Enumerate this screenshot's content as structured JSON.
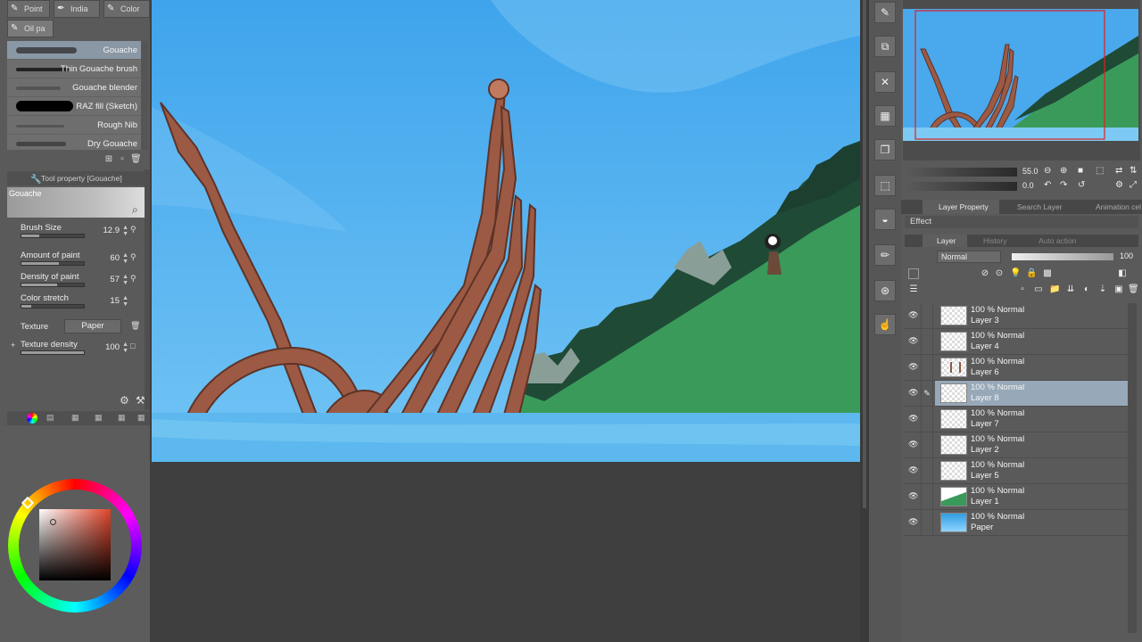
{
  "subtool_tabs": [
    {
      "label": "Point",
      "icon": "pencil-icon"
    },
    {
      "label": "India",
      "icon": "pen-icon"
    },
    {
      "label": "Color",
      "icon": "brush-icon"
    },
    {
      "label": "Oil pa",
      "icon": "oil-brush-icon"
    }
  ],
  "brushes": [
    {
      "name": "Gouache",
      "selected": true
    },
    {
      "name": "Thin Gouache brush",
      "selected": false
    },
    {
      "name": "Gouache blender",
      "selected": false
    },
    {
      "name": "RAZ fill (Sketch)",
      "selected": false
    },
    {
      "name": "Rough Nib",
      "selected": false
    },
    {
      "name": "Dry Gouache",
      "selected": false
    }
  ],
  "tool_property": {
    "header": "Tool property [Gouache]",
    "preview_name": "Gouache",
    "brush_size": {
      "label": "Brush Size",
      "value": "12.9",
      "fraction": 0.28
    },
    "amount_of_paint": {
      "label": "Amount of paint",
      "value": "60",
      "fraction": 0.6
    },
    "density_of_paint": {
      "label": "Density of paint",
      "value": "57",
      "fraction": 0.57
    },
    "color_stretch": {
      "label": "Color stretch",
      "value": "15",
      "fraction": 0.15
    },
    "texture": {
      "label": "Texture",
      "value": "Paper"
    },
    "texture_density": {
      "label": "Texture density",
      "value": "100",
      "fraction": 1.0
    }
  },
  "color": {
    "main_hex": "#e0442a"
  },
  "navigator": {
    "zoom": "55.0",
    "rotation": "0.0"
  },
  "right_tabs": {
    "layer_property": "Layer Property",
    "search_layer": "Search Layer",
    "animation_cel": "Animation cel"
  },
  "effect_label": "Effect",
  "layer_tabs": {
    "layer": "Layer",
    "history": "History",
    "auto_action": "Auto action"
  },
  "blend_mode": "Normal",
  "opacity": "100",
  "layers": [
    {
      "mode": "100 % Normal",
      "name": "Layer 3",
      "thumb": "blank",
      "selected": false
    },
    {
      "mode": "100 % Normal",
      "name": "Layer 4",
      "thumb": "blank",
      "selected": false
    },
    {
      "mode": "100 % Normal",
      "name": "Layer 6",
      "thumb": "sketch",
      "selected": false
    },
    {
      "mode": "100 % Normal",
      "name": "Layer 8",
      "thumb": "blank",
      "selected": true
    },
    {
      "mode": "100 % Normal",
      "name": "Layer 7",
      "thumb": "blank",
      "selected": false
    },
    {
      "mode": "100 % Normal",
      "name": "Layer 2",
      "thumb": "blank",
      "selected": false
    },
    {
      "mode": "100 % Normal",
      "name": "Layer 5",
      "thumb": "blank",
      "selected": false
    },
    {
      "mode": "100 % Normal",
      "name": "Layer 1",
      "thumb": "land",
      "selected": false
    },
    {
      "mode": "100 % Normal",
      "name": "Paper",
      "thumb": "paper",
      "selected": false
    }
  ],
  "icons": {
    "eye": "eye-icon",
    "pen": "pen-icon",
    "lock": "lock-icon",
    "search": "search-icon"
  }
}
